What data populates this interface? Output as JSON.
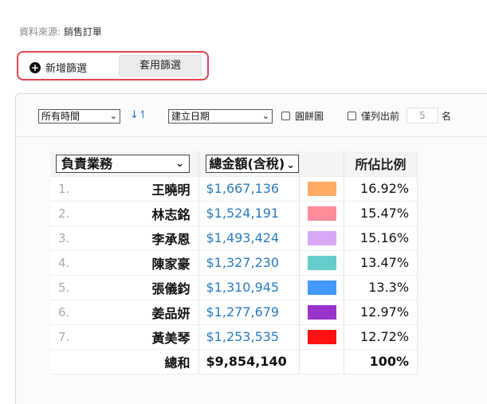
{
  "source": {
    "label": "資料來源:",
    "value": "銷售訂單"
  },
  "filters": {
    "add_label": "新增篩選",
    "apply_label": "套用篩選"
  },
  "toolbar": {
    "time_select": "所有時間",
    "date_select": "建立日期",
    "pie_label": "圓餅圖",
    "topn_label": "僅列出前",
    "topn_value": "5",
    "topn_suffix": "名"
  },
  "table": {
    "col1_select": "負責業務",
    "col2_select": "總金額(含稅)",
    "col4_header": "所佔比例",
    "rows": [
      {
        "rank": "1.",
        "name": "王曉明",
        "amount": "$1,667,136",
        "color": "#ffaa66",
        "pct": "16.92%"
      },
      {
        "rank": "2.",
        "name": "林志銘",
        "amount": "$1,524,191",
        "color": "#ff8a99",
        "pct": "15.47%"
      },
      {
        "rank": "3.",
        "name": "李承恩",
        "amount": "$1,493,424",
        "color": "#d8a8f8",
        "pct": "15.16%"
      },
      {
        "rank": "4.",
        "name": "陳家豪",
        "amount": "$1,327,230",
        "color": "#66cccc",
        "pct": "13.47%"
      },
      {
        "rank": "5.",
        "name": "張儀鈞",
        "amount": "$1,310,945",
        "color": "#4499ff",
        "pct": "13.3%"
      },
      {
        "rank": "6.",
        "name": "姜品妍",
        "amount": "$1,277,679",
        "color": "#9933cc",
        "pct": "12.97%"
      },
      {
        "rank": "7.",
        "name": "黃美琴",
        "amount": "$1,253,535",
        "color": "#ff1111",
        "pct": "12.72%"
      }
    ],
    "total": {
      "label": "總和",
      "amount": "$9,854,140",
      "pct": "100%"
    }
  }
}
